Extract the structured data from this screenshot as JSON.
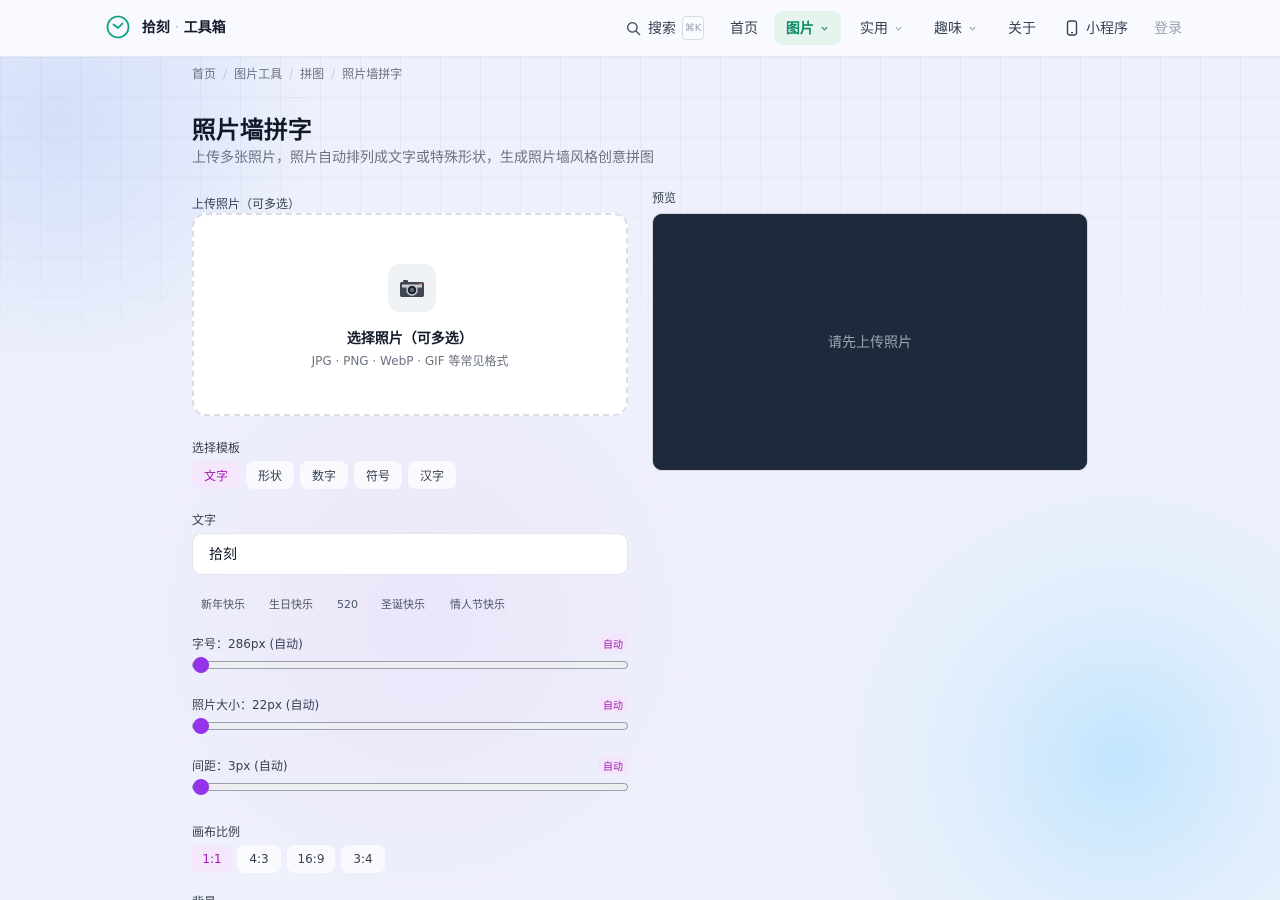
{
  "header": {
    "brand": "拾刻",
    "separator": "·",
    "brand_sub": "工具箱",
    "search_label": "搜索",
    "search_shortcut": "⌘K",
    "nav": [
      {
        "label": "首页"
      },
      {
        "label": "图片"
      },
      {
        "label": "实用"
      },
      {
        "label": "趣味"
      },
      {
        "label": "关于"
      },
      {
        "label": "小程序"
      }
    ],
    "login": "登录"
  },
  "breadcrumb": [
    "首页",
    "图片工具",
    "拼图",
    "照片墙拼字"
  ],
  "page": {
    "title": "照片墙拼字",
    "subtitle": "上传多张照片，照片自动排列成文字或特殊形状，生成照片墙风格创意拼图"
  },
  "upload": {
    "label": "上传照片（可多选）",
    "title": "选择照片（可多选）",
    "hint": "JPG · PNG · WebP · GIF 等常见格式"
  },
  "preview": {
    "label": "预览",
    "empty_text": "请先上传照片"
  },
  "template": {
    "label": "选择模板",
    "options": [
      "文字",
      "形状",
      "数字",
      "符号",
      "汉字"
    ],
    "selected": "文字"
  },
  "text": {
    "label": "文字",
    "value": "拾刻",
    "presets": [
      "新年快乐",
      "生日快乐",
      "520",
      "圣诞快乐",
      "情人节快乐"
    ]
  },
  "sliders": [
    {
      "label": "字号：286px (自动)",
      "badge": "自动",
      "value_fraction": 0
    },
    {
      "label": "照片大小：22px (自动)",
      "badge": "自动",
      "value_fraction": 0
    },
    {
      "label": "间距：3px (自动)",
      "badge": "自动",
      "value_fraction": 0
    }
  ],
  "ratio": {
    "label": "画布比例",
    "options": [
      "1:1",
      "4:3",
      "16:9",
      "3:4"
    ],
    "selected": "1:1"
  },
  "background": {
    "label": "背景"
  },
  "colors": {
    "accent_green": "#0f8a66",
    "accent_purple": "#9333ea",
    "preview_bg": "#1e293b"
  }
}
